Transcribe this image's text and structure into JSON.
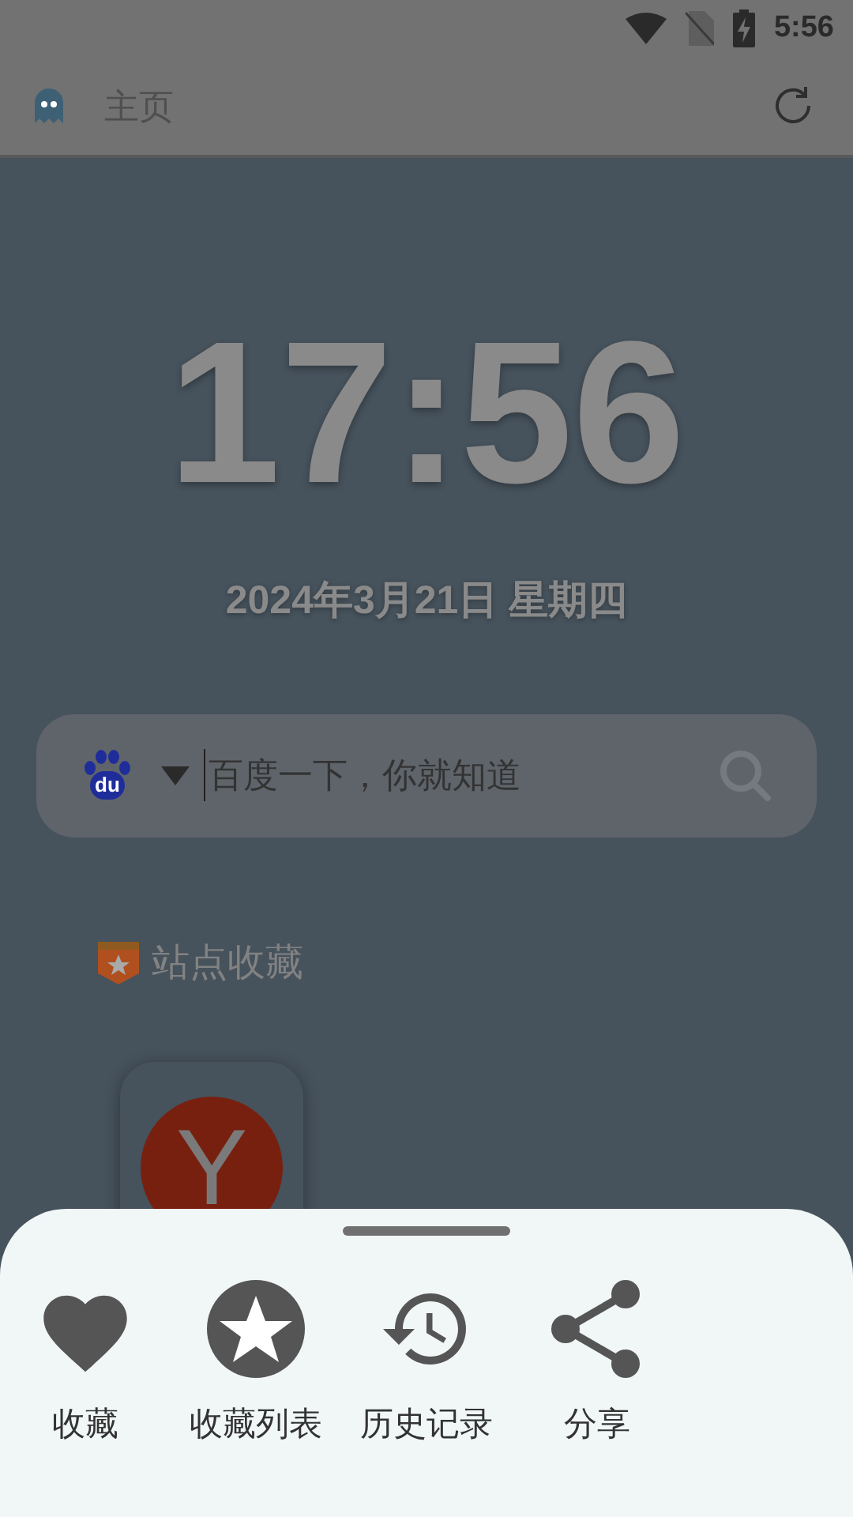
{
  "status_bar": {
    "time": "5:56"
  },
  "app_bar": {
    "title": "主页"
  },
  "clock": {
    "time": "17:56",
    "date": "2024年3月21日 星期四"
  },
  "search": {
    "engine_logo_text": "du",
    "placeholder": "百度一下，你就知道"
  },
  "favorites": {
    "title": "站点收藏",
    "sites": [
      {
        "logo_letter": "Y",
        "color": "#78200f"
      }
    ]
  },
  "sheet": {
    "actions": [
      {
        "kind": "heart",
        "label": "收藏"
      },
      {
        "kind": "star",
        "label": "收藏列表"
      },
      {
        "kind": "history",
        "label": "历史记录"
      },
      {
        "kind": "share",
        "label": "分享"
      }
    ]
  }
}
